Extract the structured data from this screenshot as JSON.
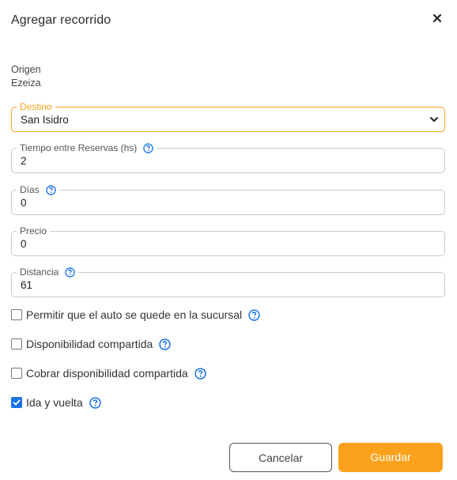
{
  "dialog": {
    "title": "Agregar recorrido",
    "close_icon": "close-icon"
  },
  "origin": {
    "label": "Origen",
    "value": "Ezeiza"
  },
  "fields": {
    "destino": {
      "label": "Destino",
      "value": "San Isidro"
    },
    "tiempo": {
      "label": "Tiempo entre Reservas (hs)",
      "value": "2"
    },
    "dias": {
      "label": "Días",
      "value": "0"
    },
    "precio": {
      "label": "Precio",
      "value": "0"
    },
    "distancia": {
      "label": "Distancia",
      "value": "61"
    }
  },
  "checkboxes": {
    "permitir": {
      "label": "Permitir que el auto se quede en la sucursal",
      "checked": false
    },
    "disponibilidad": {
      "label": "Disponibilidad compartida",
      "checked": false
    },
    "cobrar": {
      "label": "Cobrar disponibilidad compartida",
      "checked": false
    },
    "ida_vuelta": {
      "label": "Ida y vuelta",
      "checked": true
    }
  },
  "buttons": {
    "cancel": "Cancelar",
    "save": "Guardar"
  },
  "colors": {
    "accent": "#fba11b",
    "help_icon": "#1a73e8",
    "checkbox_checked": "#1a73e8"
  }
}
